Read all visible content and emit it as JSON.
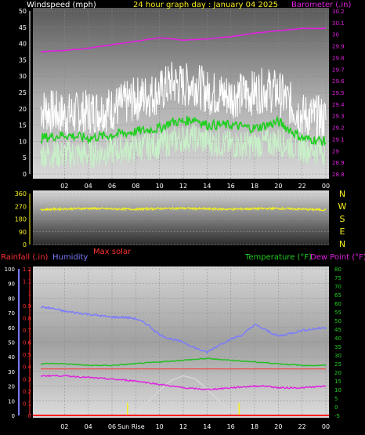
{
  "chart_data": [
    {
      "type": "line",
      "title": "24 hour graph day : January 04 2025",
      "left_axis_label": "Windspeed (mph)",
      "right_axis_label": "Barometer (.in)",
      "ylim_left": [
        0,
        50
      ],
      "ylim_right": [
        28.8,
        30.2
      ],
      "yticks_left": [
        "0",
        "5",
        "10",
        "15",
        "20",
        "25",
        "30",
        "35",
        "40",
        "45",
        "50"
      ],
      "yticks_right": [
        "28.8",
        "28.9",
        "29",
        "29.1",
        "29.2",
        "29.3",
        "29.4",
        "29.5",
        "29.6",
        "29.7",
        "29.8",
        "29.9",
        "30",
        "30.1",
        "30.2"
      ],
      "xticks": [
        "02",
        "04",
        "06",
        "08",
        "10",
        "12",
        "14",
        "16",
        "18",
        "20",
        "22",
        "00"
      ],
      "grid": true,
      "series": [
        {
          "key": "barometer",
          "color": "#e020e0",
          "points": [
            [
              0,
              29.85
            ],
            [
              2,
              29.86
            ],
            [
              4,
              29.88
            ],
            [
              6,
              29.91
            ],
            [
              8,
              29.94
            ],
            [
              10,
              29.97
            ],
            [
              12,
              29.95
            ],
            [
              14,
              29.96
            ],
            [
              16,
              29.98
            ],
            [
              18,
              30.01
            ],
            [
              20,
              30.03
            ],
            [
              22,
              30.05
            ],
            [
              24,
              30.05
            ]
          ]
        },
        {
          "key": "wind_gust",
          "color": "#ffffff",
          "points": [
            [
              0,
              20
            ],
            [
              2,
              18
            ],
            [
              4,
              19
            ],
            [
              6,
              20
            ],
            [
              8,
              23
            ],
            [
              10,
              25
            ],
            [
              11,
              28
            ],
            [
              12,
              27
            ],
            [
              13,
              28
            ],
            [
              14,
              25
            ],
            [
              16,
              24
            ],
            [
              18,
              25
            ],
            [
              19,
              26
            ],
            [
              20,
              25
            ],
            [
              22,
              18
            ],
            [
              24,
              17
            ]
          ]
        },
        {
          "key": "wind_avg",
          "color": "#20d020",
          "points": [
            [
              0,
              11
            ],
            [
              2,
              12
            ],
            [
              4,
              11
            ],
            [
              6,
              12
            ],
            [
              8,
              13
            ],
            [
              10,
              14
            ],
            [
              11,
              16
            ],
            [
              12,
              16
            ],
            [
              13,
              17
            ],
            [
              14,
              15
            ],
            [
              16,
              15
            ],
            [
              18,
              14
            ],
            [
              20,
              16
            ],
            [
              22,
              11
            ],
            [
              24,
              10
            ]
          ]
        },
        {
          "key": "wind_speed",
          "color": "#c8f0c8",
          "points": [
            [
              0,
              6
            ],
            [
              2,
              6
            ],
            [
              4,
              6
            ],
            [
              6,
              7
            ],
            [
              8,
              8
            ],
            [
              10,
              9
            ],
            [
              12,
              11
            ],
            [
              13,
              11
            ],
            [
              14,
              10
            ],
            [
              16,
              9
            ],
            [
              18,
              9
            ],
            [
              20,
              10
            ],
            [
              22,
              8
            ],
            [
              24,
              7
            ]
          ]
        }
      ]
    },
    {
      "type": "line",
      "left_axis_label": "",
      "ylim": [
        0,
        360
      ],
      "yticks": [
        "0",
        "90",
        "180",
        "270",
        "360"
      ],
      "right_labels": [
        "N",
        "W",
        "S",
        "E",
        "N"
      ],
      "series": [
        {
          "key": "wind_direction",
          "color": "#f0f020",
          "points": [
            [
              0,
              248
            ],
            [
              2,
              252
            ],
            [
              4,
              255
            ],
            [
              6,
              252
            ],
            [
              8,
              250
            ],
            [
              10,
              254
            ],
            [
              12,
              256
            ],
            [
              14,
              252
            ],
            [
              16,
              250
            ],
            [
              18,
              253
            ],
            [
              20,
              255
            ],
            [
              22,
              250
            ],
            [
              24,
              245
            ]
          ]
        }
      ]
    },
    {
      "type": "line",
      "labels": {
        "rainfall": "Rainfall (.in)",
        "humidity": "Humidity",
        "max_solar": "Max solar",
        "temperature": "Temperature (°F)",
        "dew_point": "Dew Point (°F)",
        "sunrise": "Sun Rise"
      },
      "ylim_humidity": [
        0,
        100
      ],
      "ylim_rain": [
        0,
        1.2
      ],
      "ylim_temp": [
        -5,
        80
      ],
      "yticks_humidity": [
        "0",
        "10",
        "20",
        "30",
        "40",
        "50",
        "60",
        "70",
        "80",
        "90",
        "100"
      ],
      "yticks_rain": [
        "0",
        "0.1",
        "0.2",
        "0.3",
        "0.4",
        "0.5",
        "0.6",
        "0.7",
        "0.8",
        "0.9",
        "1",
        "1.1",
        "1.2"
      ],
      "yticks_temp": [
        "-5",
        "0",
        "5",
        "10",
        "15",
        "20",
        "25",
        "30",
        "35",
        "40",
        "45",
        "50",
        "55",
        "60",
        "65",
        "70",
        "75",
        "80"
      ],
      "xticks": [
        "02",
        "04",
        "06",
        "08",
        "10",
        "12",
        "14",
        "16",
        "18",
        "20",
        "22",
        "00"
      ],
      "sunrise_hour": 7.3,
      "sunset_hour": 16.7,
      "series": [
        {
          "key": "humidity",
          "color": "#7b7bff",
          "axis": "humidity",
          "points": [
            [
              0,
              74
            ],
            [
              1,
              73
            ],
            [
              2,
              71
            ],
            [
              3,
              70
            ],
            [
              4,
              69
            ],
            [
              5,
              68
            ],
            [
              6,
              67
            ],
            [
              7,
              67
            ],
            [
              8,
              66
            ],
            [
              9,
              62
            ],
            [
              10,
              55
            ],
            [
              11,
              52
            ],
            [
              12,
              50
            ],
            [
              13,
              46
            ],
            [
              14,
              43
            ],
            [
              15,
              48
            ],
            [
              16,
              52
            ],
            [
              17,
              55
            ],
            [
              18,
              62
            ],
            [
              19,
              58
            ],
            [
              20,
              54
            ],
            [
              21,
              56
            ],
            [
              22,
              58
            ],
            [
              23,
              59
            ],
            [
              24,
              60
            ]
          ]
        },
        {
          "key": "temperature",
          "color": "#20c020",
          "axis": "temp",
          "points": [
            [
              0,
              25
            ],
            [
              2,
              25
            ],
            [
              4,
              24
            ],
            [
              6,
              24
            ],
            [
              8,
              25
            ],
            [
              10,
              26
            ],
            [
              12,
              27
            ],
            [
              14,
              28
            ],
            [
              16,
              27
            ],
            [
              18,
              26
            ],
            [
              20,
              25
            ],
            [
              22,
              24
            ],
            [
              24,
              24
            ]
          ]
        },
        {
          "key": "dew_point",
          "color": "#e020e0",
          "axis": "temp",
          "points": [
            [
              0,
              18
            ],
            [
              2,
              18
            ],
            [
              4,
              17
            ],
            [
              6,
              16
            ],
            [
              8,
              15
            ],
            [
              10,
              13
            ],
            [
              12,
              11
            ],
            [
              14,
              10
            ],
            [
              16,
              11
            ],
            [
              18,
              12
            ],
            [
              19,
              12
            ],
            [
              20,
              11
            ],
            [
              22,
              11
            ],
            [
              24,
              12
            ]
          ]
        },
        {
          "key": "solar",
          "color": "#d8d8d8",
          "axis": "humidity",
          "points": [
            [
              7.3,
              0
            ],
            [
              8,
              3
            ],
            [
              9,
              9
            ],
            [
              10,
              17
            ],
            [
              11,
              24
            ],
            [
              12,
              27
            ],
            [
              13,
              25
            ],
            [
              14,
              18
            ],
            [
              15,
              10
            ],
            [
              16,
              3
            ],
            [
              16.7,
              0
            ]
          ]
        },
        {
          "key": "rain_rate",
          "color": "#ff3030",
          "axis": "rain",
          "points": [
            [
              0,
              0.38
            ],
            [
              24,
              0.38
            ]
          ]
        }
      ]
    }
  ],
  "colors": {
    "title": "#f8f020",
    "windspeed_label": "#ffffff",
    "barometer_label": "#e020e0",
    "rainfall_label": "#ff3030",
    "humidity_label": "#7b7bff",
    "temperature_label": "#20d020",
    "dew_label": "#e020e0",
    "max_solar_label": "#ff3030"
  }
}
